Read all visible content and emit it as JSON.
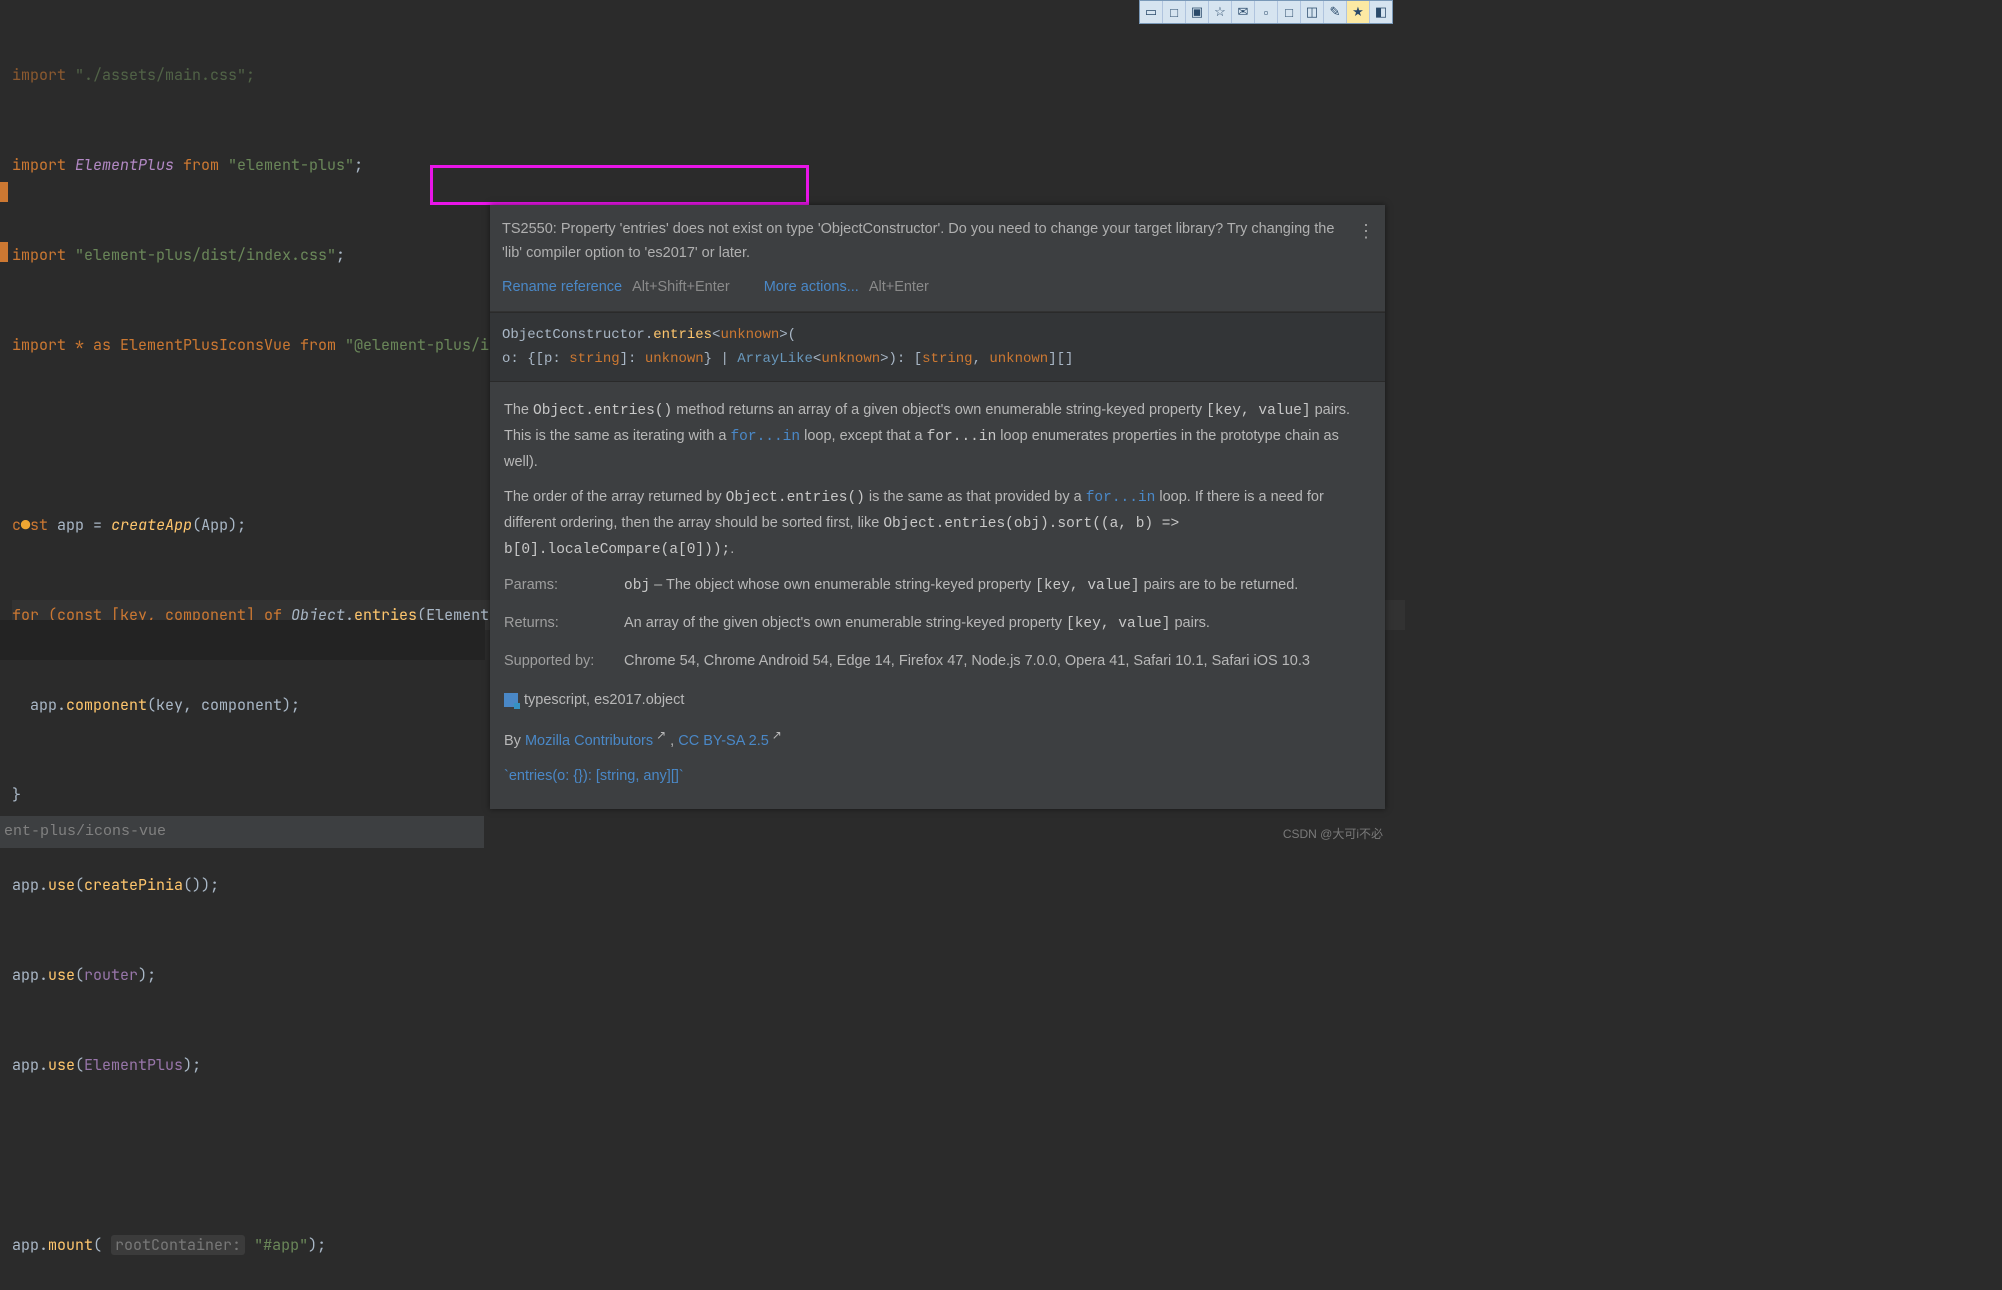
{
  "code": {
    "l0a": "import",
    "l0b": " \"./assets/main.css\";",
    "l1a": "import ",
    "l1b": "ElementPlus",
    "l1c": " from ",
    "l1d": "\"element-plus\"",
    "l1e": ";",
    "l2a": "import ",
    "l2b": "\"element-plus/dist/index.css\"",
    "l2c": ";",
    "l3a": "import * as ElementPlusIconsVue from ",
    "l3b": "\"@element-plus/icons-vue\"",
    "l3c": ";",
    "l5a": "c",
    "l5b": "●",
    "l5c": "st",
    "l5d": " app = ",
    "l5e": "createApp",
    "l5f": "(App);",
    "l6a": "for (const [key, component] of ",
    "l6b": "Object",
    "l6c": ".",
    "l6d": "entries",
    "l6e": "(ElementPlusIconsVue)) {",
    "l7a": "  app.",
    "l7b": "component",
    "l7c": "(key, component);",
    "l8a": "}",
    "l9a": "app.",
    "l9b": "use",
    "l9c": "(",
    "l9d": "createPinia",
    "l9e": "());",
    "l10a": "app.",
    "l10b": "use",
    "l10c": "(",
    "l10d": "router",
    "l10e": ");",
    "l11a": "app.",
    "l11b": "use",
    "l11c": "(",
    "l11d": "ElementPlus",
    "l11e": ");",
    "l13a": "app.",
    "l13b": "mount",
    "l13c": "( ",
    "l13hint": "rootContainer:",
    "l13d": " \"#app\"",
    "l13e": ");"
  },
  "popup": {
    "error": "TS2550: Property 'entries' does not exist on type 'ObjectConstructor'. Do you need to change your target library? Try changing the 'lib' compiler option to 'es2017' or later.",
    "rename": "Rename reference",
    "rename_sc": "Alt+Shift+Enter",
    "more": "More actions...",
    "more_sc": "Alt+Enter",
    "sig_pre": "ObjectConstructor.",
    "sig_name": "entries",
    "sig_gen": "<",
    "sig_unk": "unknown",
    "sig_close": ">(",
    "sig2a": "     o: {[p: ",
    "sig2b": "string",
    "sig2c": "]: ",
    "sig2d": "unknown",
    "sig2e": "} | ",
    "sig2f": "ArrayLike",
    "sig2g": "<",
    "sig2h": "unknown",
    "sig2i": ">): [",
    "sig2j": "string",
    "sig2k": ", ",
    "sig2l": "unknown",
    "sig2m": "][]",
    "p1a": "The ",
    "p1b": "Object.entries()",
    "p1c": " method returns an array of a given object's own enumerable string-keyed property ",
    "p1d": "[key, value]",
    "p1e": " pairs. This is the same as iterating with a ",
    "p1f": "for...in",
    "p1g": " loop, except that a ",
    "p1h": "for...in",
    "p1i": " loop enumerates properties in the prototype chain as well).",
    "p2a": "The order of the array returned by ",
    "p2b": "Object.entries()",
    "p2c": " is the same as that provided by a ",
    "p2d": "for...in",
    "p2e": " loop. If there is a need for different ordering, then the array should be sorted first, like ",
    "p2f": "Object.entries(obj).sort((a, b) => b[0].localeCompare(a[0]));",
    "p2g": ".",
    "params_lbl": "Params:",
    "params_a": "obj",
    "params_b": " – The object whose own enumerable string-keyed property ",
    "params_c": "[key, value]",
    "params_d": " pairs are to be returned.",
    "returns_lbl": "Returns:",
    "returns_a": "An array of the given object's own enumerable string-keyed property ",
    "returns_b": "[key, value]",
    "returns_c": " pairs.",
    "support_lbl": "Supported by:",
    "support_v": "Chrome 54, Chrome Android 54, Edge 14, Firefox 47, Node.js 7.0.0, Opera 41, Safari 10.1, Safari iOS 10.3",
    "src": "typescript, es2017.object",
    "by": "By ",
    "moz": "Mozilla Contributors",
    "cc": "CC BY-SA 2.5",
    "footer": "`entries(o: {}): [string, any][]`"
  },
  "status": "ent-plus/icons-vue",
  "watermark": "CSDN @大可i不必"
}
